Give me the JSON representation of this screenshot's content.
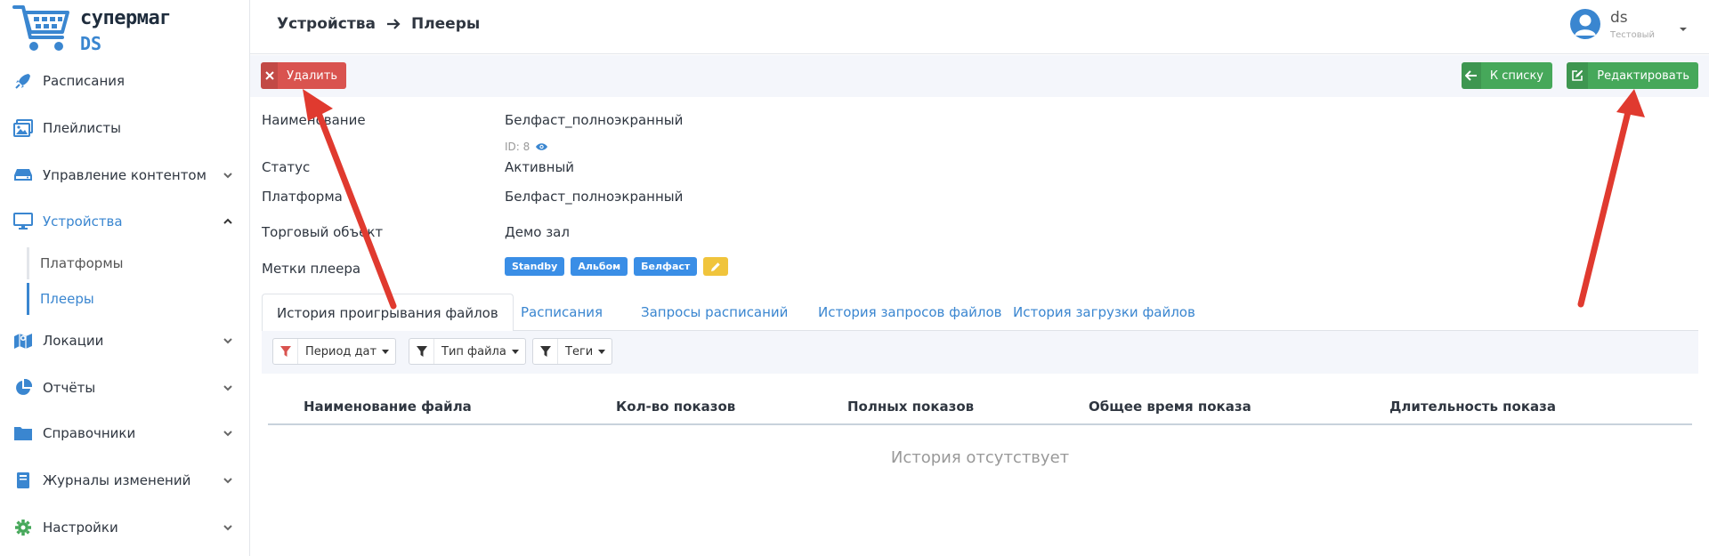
{
  "logo": {
    "title": "супермаг",
    "subtitle": "DS"
  },
  "sidebar": {
    "items": [
      {
        "label": "Расписания",
        "icon": "rocket-icon"
      },
      {
        "label": "Плейлисты",
        "icon": "images-icon"
      },
      {
        "label": "Управление контентом",
        "icon": "hdd-icon"
      },
      {
        "label": "Устройства",
        "icon": "monitor-icon"
      },
      {
        "label": "Локации",
        "icon": "map-icon"
      },
      {
        "label": "Отчёты",
        "icon": "pie-chart-icon"
      },
      {
        "label": "Справочники",
        "icon": "folder-icon"
      },
      {
        "label": "Журналы изменений",
        "icon": "book-icon"
      },
      {
        "label": "Настройки",
        "icon": "gear-icon"
      }
    ],
    "subitems": [
      {
        "label": "Платформы"
      },
      {
        "label": "Плееры"
      }
    ]
  },
  "header": {
    "breadcrumb": [
      "Устройства",
      "Плееры"
    ],
    "user": {
      "name": "ds",
      "role": "Тестовый"
    }
  },
  "toolbar": {
    "delete_label": "Удалить",
    "back_label": "К списку",
    "edit_label": "Редактировать"
  },
  "details": {
    "name_key": "Наименование",
    "name_value": "Белфаст_полноэкранный",
    "id_text": "ID: 8",
    "status_key": "Статус",
    "status_value": "Активный",
    "platform_key": "Платформа",
    "platform_value": "Белфаст_полноэкранный",
    "store_key": "Торговый объект",
    "store_value": "Демо зал",
    "tags_key": "Метки плеера",
    "tags": [
      "Standby",
      "Альбом",
      "Белфаст"
    ]
  },
  "tabs": [
    "История проигрывания файлов",
    "Расписания",
    "Запросы расписаний",
    "История запросов файлов",
    "История загрузки файлов"
  ],
  "filters": [
    "Период дат",
    "Тип файла",
    "Теги"
  ],
  "table": {
    "columns": [
      "Наименование файла",
      "Кол-во показов",
      "Полных показов",
      "Общее время показа",
      "Длительность показа"
    ],
    "empty_text": "История отсутствует"
  },
  "colors": {
    "accent": "#3a86d0",
    "danger": "#d9534f",
    "success": "#46a85a",
    "tag": "#3a8ee6",
    "annotation": "#e03a2f"
  }
}
